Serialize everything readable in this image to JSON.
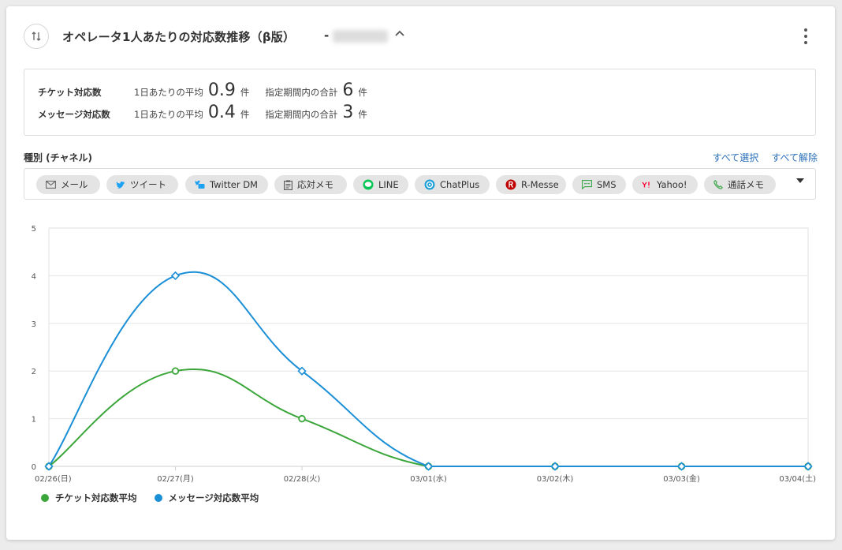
{
  "header": {
    "title": "オペレータ1人あたりの対応数推移（β版）",
    "separator": "-",
    "sort_icon": "sort-arrows-icon",
    "collapse_icon": "chevron-up-icon",
    "more_icon": "more-vertical-icon"
  },
  "summary": {
    "rows": [
      {
        "label": "チケット対応数",
        "avg_label": "1日あたりの平均",
        "avg_value": "0.9",
        "unit": "件",
        "total_label": "指定期間内の合計",
        "total_value": "6",
        "total_unit": "件"
      },
      {
        "label": "メッセージ対応数",
        "avg_label": "1日あたりの平均",
        "avg_value": "0.4",
        "unit": "件",
        "total_label": "指定期間内の合計",
        "total_value": "3",
        "total_unit": "件"
      }
    ]
  },
  "filter": {
    "section_label": "種別 (チャネル)",
    "select_all": "すべて選択",
    "deselect_all": "すべて解除",
    "channels": [
      {
        "label": "メール",
        "icon": "mail-icon",
        "color": "#666666"
      },
      {
        "label": "ツイート",
        "icon": "twitter-icon",
        "color": "#1da1f2"
      },
      {
        "label": "Twitter DM",
        "icon": "twitter-dm-icon",
        "color": "#1da1f2"
      },
      {
        "label": "応対メモ",
        "icon": "clipboard-icon",
        "color": "#555555"
      },
      {
        "label": "LINE",
        "icon": "line-icon",
        "color": "#06c755"
      },
      {
        "label": "ChatPlus",
        "icon": "chatplus-icon",
        "color": "#1fa0d8"
      },
      {
        "label": "R-Messe",
        "icon": "rakuten-icon",
        "color": "#bf0000"
      },
      {
        "label": "SMS",
        "icon": "sms-icon",
        "color": "#3aa64a"
      },
      {
        "label": "Yahoo!",
        "icon": "yahoo-icon",
        "color": "#ff0033"
      },
      {
        "label": "通話メモ",
        "icon": "phone-icon",
        "color": "#3aa64a"
      }
    ],
    "dropdown_icon": "caret-down-icon"
  },
  "chart_data": {
    "type": "line",
    "categories": [
      "02/26(日)",
      "02/27(月)",
      "02/28(火)",
      "03/01(水)",
      "03/02(木)",
      "03/03(金)",
      "03/04(土)"
    ],
    "series": [
      {
        "name": "チケット対応数平均",
        "values": [
          0,
          2,
          1,
          0,
          0,
          0,
          0
        ],
        "color": "#3aa63a",
        "marker": "circle"
      },
      {
        "name": "メッセージ対応数平均",
        "values": [
          0,
          4,
          2,
          0,
          0,
          0,
          0
        ],
        "color": "#1a8fd6",
        "marker": "diamond"
      }
    ],
    "yticks": [
      "0",
      "1",
      "2",
      "3",
      "4",
      "5"
    ],
    "ylim": [
      0,
      5
    ],
    "grid": true,
    "legend_position": "bottom-left"
  }
}
